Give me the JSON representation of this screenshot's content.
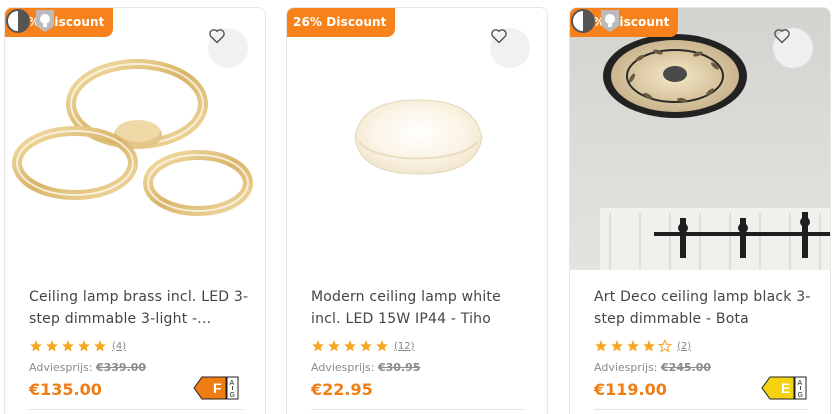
{
  "products": [
    {
      "badge": "60% Discount",
      "title": "Ceiling lamp brass incl. LED 3-step dimmable 3-light -...",
      "rating": 5,
      "review_count": "(4)",
      "advice_label": "Adviesprijs:",
      "old_price": "€339.00",
      "price": "€135.00",
      "energy": {
        "class": "F",
        "scale_top": "A",
        "scale_bottom": "G",
        "color": "#f07d14"
      }
    },
    {
      "badge": "26% Discount",
      "title": "Modern ceiling lamp white incl. LED 15W IP44 - Tiho",
      "rating": 5,
      "review_count": "(12)",
      "advice_label": "Adviesprijs:",
      "old_price": "€30.95",
      "price": "€22.95"
    },
    {
      "badge": "51% Discount",
      "title": "Art Deco ceiling lamp black 3-step dimmable - Bota",
      "rating": 4,
      "review_count": "(2)",
      "advice_label": "Adviesprijs:",
      "old_price": "€245.00",
      "price": "€119.00",
      "energy": {
        "class": "E",
        "scale_top": "A",
        "scale_bottom": "G",
        "color": "#f5d20f"
      }
    }
  ],
  "colors": {
    "accent": "#f7821b",
    "price": "#f07d14",
    "star": "#f5a623"
  },
  "icons": [
    "heart-icon",
    "star-icon",
    "dimmable-icon",
    "bulb-included-icon"
  ]
}
